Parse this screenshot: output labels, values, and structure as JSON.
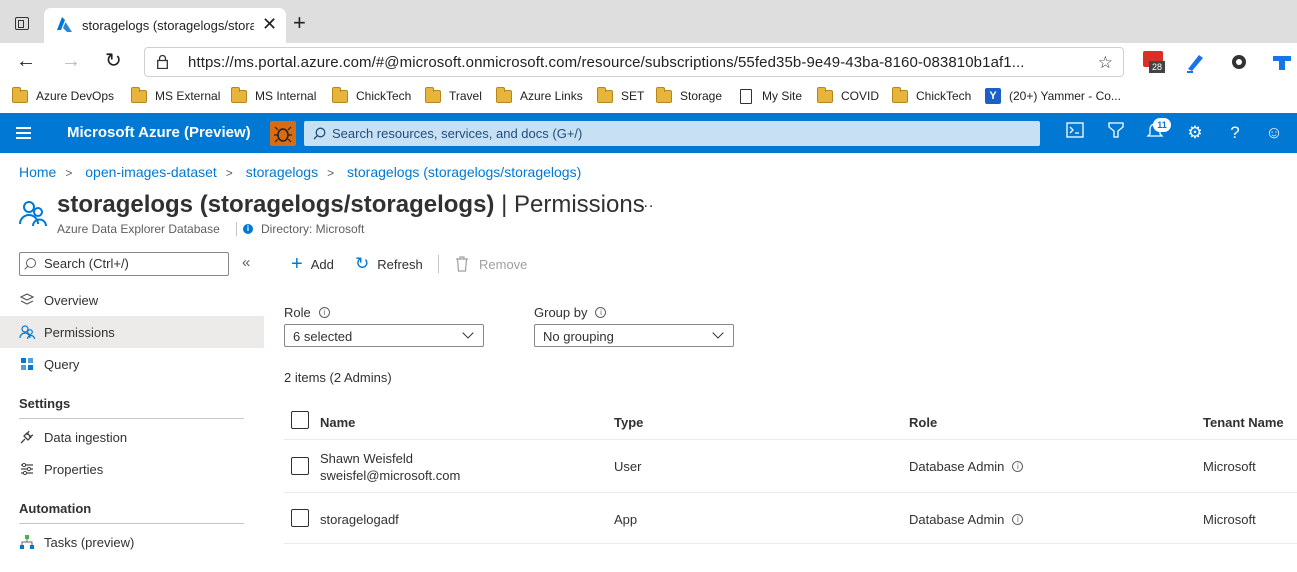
{
  "browser": {
    "tab_title": "storagelogs (storagelogs/storage",
    "address": "https://ms.portal.azure.com/#@microsoft.onmicrosoft.com/resource/subscriptions/55fed35b-9e49-43ba-8160-083810b1af1...",
    "ext_badge": "28",
    "bookmarks": [
      {
        "label": "Azure DevOps",
        "icon": "folder-icon"
      },
      {
        "label": "MS External",
        "icon": "folder-icon"
      },
      {
        "label": "MS Internal",
        "icon": "folder-icon"
      },
      {
        "label": "ChickTech",
        "icon": "folder-icon"
      },
      {
        "label": "Travel",
        "icon": "folder-icon"
      },
      {
        "label": "Azure Links",
        "icon": "folder-icon"
      },
      {
        "label": "SET",
        "icon": "folder-icon"
      },
      {
        "label": "Storage",
        "icon": "folder-icon"
      },
      {
        "label": "My Site",
        "icon": "page-icon"
      },
      {
        "label": "COVID",
        "icon": "folder-icon"
      },
      {
        "label": "ChickTech",
        "icon": "folder-icon"
      },
      {
        "label": "(20+) Yammer - Co...",
        "icon": "yammer-icon"
      }
    ]
  },
  "azure": {
    "brand": "Microsoft Azure (Preview)",
    "search_placeholder": "Search resources, services, and docs (G+/)",
    "notification_count": "11",
    "accent": "#0078d4"
  },
  "breadcrumb": [
    "Home",
    "open-images-dataset",
    "storagelogs",
    "storagelogs (storagelogs/storagelogs)"
  ],
  "page": {
    "title_bold": "storagelogs (storagelogs/storagelogs)",
    "title_suffix": " | Permissions",
    "more": "...",
    "subtitle": "Azure Data Explorer Database",
    "directory": "Directory: Microsoft"
  },
  "sidebar": {
    "search_placeholder": "Search (Ctrl+/)",
    "collapse": "«",
    "items": [
      {
        "label": "Overview",
        "icon": "overview-icon"
      },
      {
        "label": "Permissions",
        "icon": "people-icon"
      },
      {
        "label": "Query",
        "icon": "grid-icon"
      }
    ],
    "sections": [
      {
        "heading": "Settings",
        "items": [
          {
            "label": "Data ingestion",
            "icon": "plug-icon"
          },
          {
            "label": "Properties",
            "icon": "sliders-icon"
          }
        ]
      },
      {
        "heading": "Automation",
        "items": [
          {
            "label": "Tasks (preview)",
            "icon": "workflow-icon"
          }
        ]
      }
    ]
  },
  "toolbar": {
    "add": "Add",
    "refresh": "Refresh",
    "remove": "Remove"
  },
  "filters": {
    "role_label": "Role",
    "role_value": "6 selected",
    "group_label": "Group by",
    "group_value": "No grouping"
  },
  "summary": "2 items (2 Admins)",
  "table": {
    "columns": [
      "Name",
      "Type",
      "Role",
      "Tenant Name"
    ],
    "rows": [
      {
        "name": "Shawn Weisfeld",
        "email": "sweisfel@microsoft.com",
        "type": "User",
        "role": "Database Admin",
        "tenant": "Microsoft"
      },
      {
        "name": "storagelogadf",
        "email": "",
        "type": "App",
        "role": "Database Admin",
        "tenant": "Microsoft"
      }
    ]
  }
}
